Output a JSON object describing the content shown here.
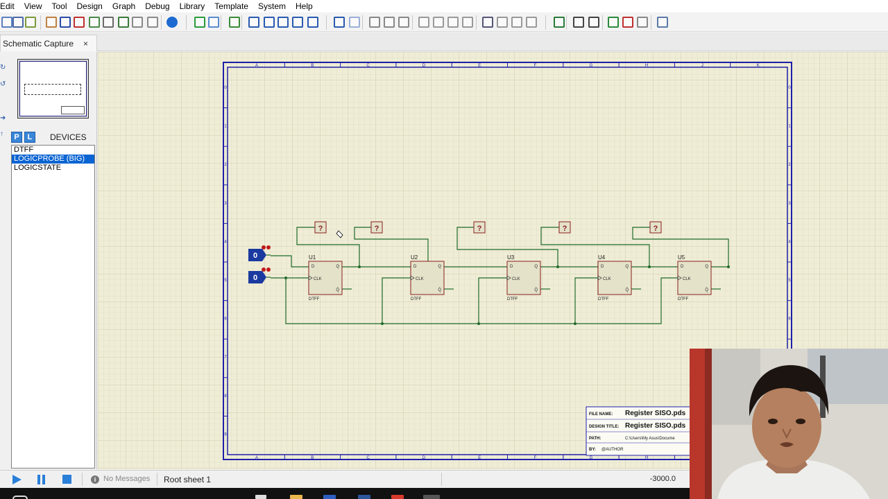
{
  "menu": [
    "Edit",
    "View",
    "Tool",
    "Design",
    "Graph",
    "Debug",
    "Library",
    "Template",
    "System",
    "Help"
  ],
  "tab": {
    "label": "Schematic Capture",
    "close": "×"
  },
  "devices": {
    "header": "DEVICES",
    "p_button": "P",
    "l_button": "L",
    "items": [
      "DTFF",
      "LOGICPROBE (BIG)",
      "LOGICSTATE"
    ],
    "selected_index": 1
  },
  "schematic": {
    "col_letters": [
      "A",
      "B",
      "C",
      "D",
      "E",
      "F",
      "G",
      "H",
      "J",
      "K"
    ],
    "row_numbers": [
      "0",
      "1",
      "2",
      "3",
      "4",
      "5",
      "6",
      "7",
      "8",
      "9"
    ],
    "flipflops": [
      {
        "ref": "U1",
        "type": "DTFF",
        "pin_d": "D",
        "pin_q": "Q",
        "pin_clk": "CLK",
        "pin_qbar": "Q̄"
      },
      {
        "ref": "U2",
        "type": "DTFF",
        "pin_d": "D",
        "pin_q": "Q",
        "pin_clk": "CLK",
        "pin_qbar": "Q̄"
      },
      {
        "ref": "U3",
        "type": "DTFF",
        "pin_d": "D",
        "pin_q": "Q",
        "pin_clk": "CLK",
        "pin_qbar": "Q̄"
      },
      {
        "ref": "U4",
        "type": "DTFF",
        "pin_d": "D",
        "pin_q": "Q",
        "pin_clk": "CLK",
        "pin_qbar": "Q̄"
      },
      {
        "ref": "U5",
        "type": "DTFF",
        "pin_d": "D",
        "pin_q": "Q",
        "pin_clk": "CLK",
        "pin_qbar": "Q̄"
      }
    ],
    "probes": [
      "?",
      "?",
      "?",
      "?",
      "?"
    ],
    "logicstates": [
      "0",
      "0"
    ],
    "title_block": {
      "file_name_label": "FILE NAME:",
      "file_name": "Register SISO.pds",
      "design_title_label": "DESIGN TITLE:",
      "design_title": "Register SISO.pds",
      "path_label": "PATH:",
      "path": "C:\\Users\\My Asus\\Docume",
      "by_label": "BY:",
      "by": "@AUTHOR"
    }
  },
  "status": {
    "messages": "No Messages",
    "sheet": "Root sheet 1",
    "coordinate": "-3000.0"
  },
  "colors": {
    "canvas_bg": "#efedd6",
    "sheet_border": "#1f1fa8",
    "component_fill": "#e4e2c9",
    "component_stroke": "#8a1f1f",
    "wire": "#1f6a2a",
    "logicstate_blue": "#1a3aa0"
  }
}
